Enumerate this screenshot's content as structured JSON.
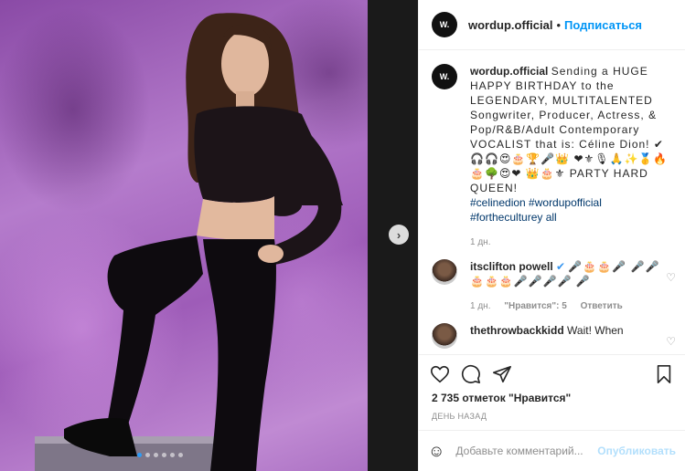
{
  "photo": {
    "carousel_dots": 6,
    "active_dot": 0
  },
  "header": {
    "username": "wordup.official",
    "separator": "•",
    "follow_label": "Подписаться",
    "avatar_text": "W."
  },
  "caption": {
    "username": "wordup.official",
    "text": "Sending a HUGE HAPPY BIRTHDAY to the LEGENDARY, MULTITALENTED Songwriter, Producer, Actress, & Pop/R&B/Adult Contemporary VOCALIST that is: Céline Dion! ✔🎧🎧😍🎂🏆🎤👑 ❤⚜🎙🙏✨🥇🔥🎂🌳😍❤ 👑🎂⚜ PARTY HARD QUEEN!",
    "hashtags": "#celinedion #wordupofficial #fortheculturey all",
    "time": "1 дн."
  },
  "comment1": {
    "username": "itsclifton powell",
    "verified": "✔",
    "text": "🎤🎂🎂🎤 🎤🎤🎂🎂🎂🎤🎤🎤🎤 🎤",
    "time": "1 дн.",
    "likes": "\"Нравится\": 5",
    "reply": "Ответить"
  },
  "comment2": {
    "username": "thethrowbackkidd",
    "text": "Wait! When"
  },
  "actions": {
    "likes_count": "2 735 отметок \"Нравится\"",
    "timestamp": "ДЕНЬ НАЗАД"
  },
  "comment_input": {
    "placeholder": "Добавьте комментарий...",
    "publish_label": "Опубликовать"
  }
}
